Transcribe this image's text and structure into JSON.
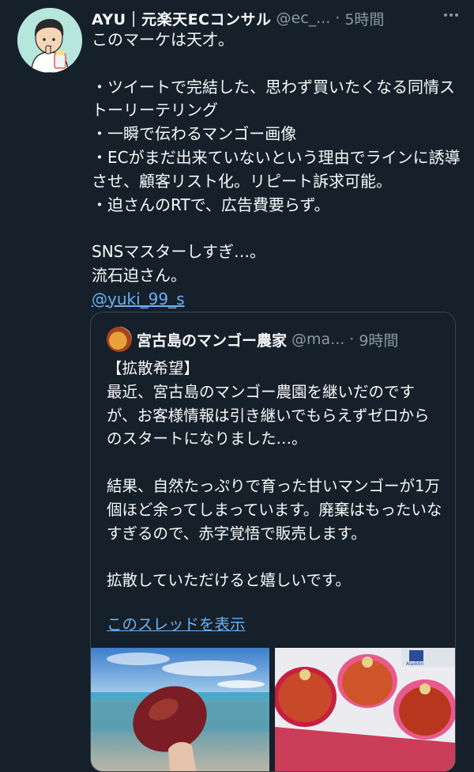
{
  "tweet": {
    "author_name": "AYU｜元楽天ECコンサル",
    "handle": "@ec_...",
    "separator": "·",
    "time": "5時間",
    "more_icon": "more-options-icon",
    "text": "このマーケは天才。\n\n・ツイートで完結した、思わず買いたくなる同情ストーリーテリング\n・一瞬で伝わるマンゴー画像\n・ECがまだ出来ていないという理由でラインに誘導させ、顧客リスト化。リピート訴求可能。\n・迫さんのRTで、広告費要らず。\n\nSNSマスターしすぎ…。\n流石迫さん。",
    "mention": "@yuki_99_s"
  },
  "quoted": {
    "author_name": "宮古島のマンゴー農家",
    "handle": "@ma...",
    "separator": "·",
    "time": "9時間",
    "text": "【拡散希望】\n最近、宮古島のマンゴー農園を継いだのですが、お客様情報は引き継いでもらえずゼロからのスタートになりました…。\n\n結果、自然たっぷりで育った甘いマンゴーが1万個ほど余ってしまっています。廃棄はもったいなすぎるので、赤字覚悟で販売します。\n\n拡散していただけると嬉しいです。",
    "show_thread": "このスレッドを表示",
    "box_logo_text": "Aladdin"
  },
  "colors": {
    "background": "#15202b",
    "text": "#f7f9f9",
    "muted": "#8b98a5",
    "link": "#6ab1f2",
    "border": "#38444d"
  }
}
